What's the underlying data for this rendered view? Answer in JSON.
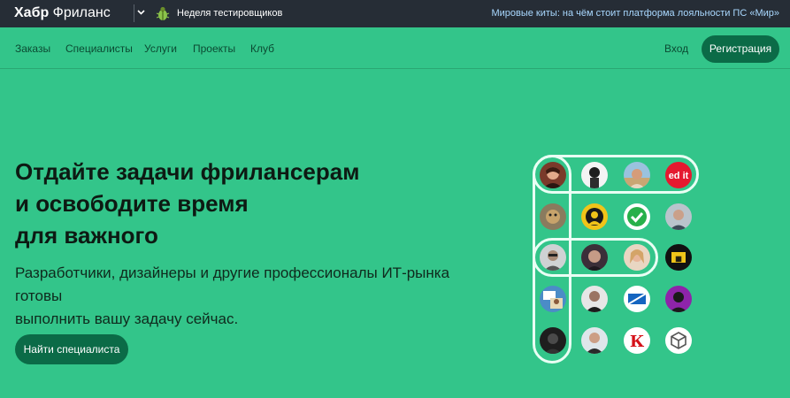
{
  "topbar": {
    "brand_bold": "Хабр",
    "brand_rest": " Фриланс",
    "brand_menu_icon": "chevron-down-icon",
    "promo_icon": "bug-icon",
    "promo_label": "Неделя тестировщиков",
    "news_link": "Мировые киты: на чём стоит платформа лояльности ПС «Мир»"
  },
  "nav": {
    "items": [
      "Заказы",
      "Специалисты",
      "Услуги",
      "Проекты",
      "Клуб"
    ],
    "login": "Вход",
    "register": "Регистрация"
  },
  "hero": {
    "title_lines": [
      "Отдайте задачи фрилансерам",
      "и освободите время",
      "для важного"
    ],
    "subtitle_lines": [
      "Разработчики, дизайнеры и другие профессионалы ИТ-рынка готовы",
      "выполнить вашу задачу сейчас."
    ],
    "cta": "Найти специалиста"
  },
  "avatars": {
    "badge_text": "ed it",
    "letter_k": "К"
  },
  "colors": {
    "background": "#33c58a",
    "topbar": "#262d36",
    "button": "#0b6b47",
    "link": "#a9d8ff"
  }
}
